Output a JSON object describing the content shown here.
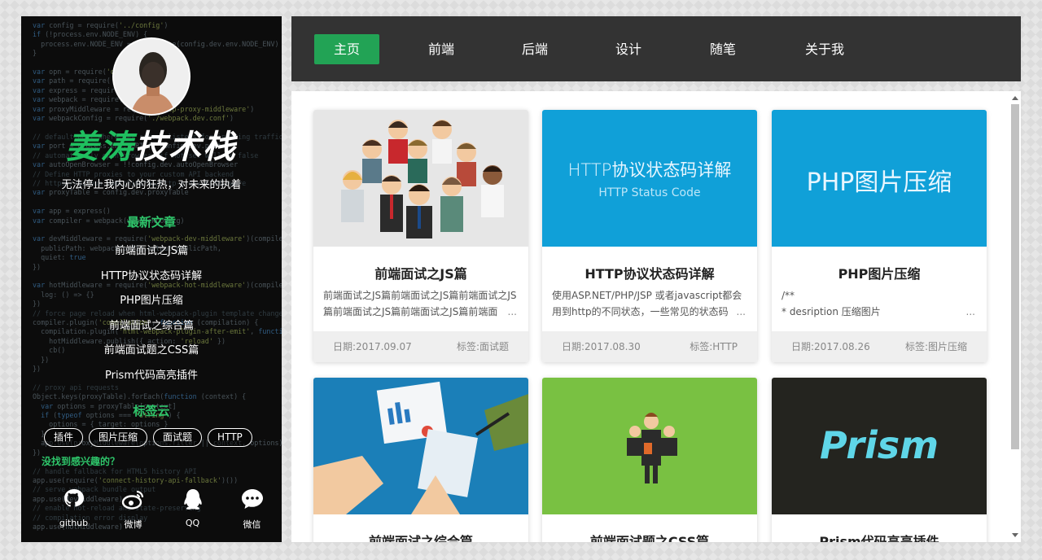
{
  "sidebar": {
    "title_part1": "姜涛",
    "title_part2": "技术栈",
    "motto": "无法停止我内心的狂热，对未来的执着",
    "recent_title": "最新文章",
    "recent": [
      "前端面试之JS篇",
      "HTTP协议状态码详解",
      "PHP图片压缩",
      "前端面试之综合篇",
      "前端面试题之CSS篇",
      "Prism代码高亮插件"
    ],
    "tag_title": "标签云",
    "tags": [
      "插件",
      "图片压缩",
      "面试题",
      "HTTP"
    ],
    "interest": "没找到感兴趣的？",
    "socials": [
      {
        "label": "github",
        "icon": "github-icon"
      },
      {
        "label": "微博",
        "icon": "weibo-icon"
      },
      {
        "label": "QQ",
        "icon": "qq-icon"
      },
      {
        "label": "微信",
        "icon": "wechat-icon"
      }
    ]
  },
  "nav": {
    "items": [
      "主页",
      "前端",
      "后端",
      "设计",
      "随笔",
      "关于我"
    ],
    "active_index": 0,
    "active_color": "#22a355"
  },
  "cards": [
    {
      "title": "前端面试之JS篇",
      "excerpt": "前端面试之JS篇前端面试之JS篇前端面试之JS篇前端面试之JS篇前端面试之JS篇前端面",
      "more": "...",
      "date": "日期:2017.09.07",
      "tag": "标签:面试题",
      "thumb_color": "#e6e6e6"
    },
    {
      "title": "HTTP协议状态码详解",
      "excerpt": "使用ASP.NET/PHP/JSP 或者javascript都会用到http的不同状态，一些常见的状态码",
      "more": "...",
      "date": "日期:2017.08.30",
      "tag": "标签:HTTP",
      "thumb_title": "HTTP协议状态码详解",
      "thumb_sub": "HTTP Status Code",
      "thumb_color": "#10a0d8"
    },
    {
      "title": "PHP图片压缩",
      "excerpt_l1": "/**",
      "excerpt_l2": "* desription 压缩图片",
      "more": "...",
      "date": "日期:2017.08.26",
      "tag": "标签:图片压缩",
      "thumb_title": "PHP图片压缩",
      "thumb_color": "#10a0d8"
    },
    {
      "title": "前端面试之综合篇",
      "thumb_color": "#1b7fb8"
    },
    {
      "title": "前端面试题之CSS篇",
      "thumb_color": "#79c142"
    },
    {
      "title": "Prism代码高亮插件",
      "thumb_title": "Prism",
      "thumb_color": "#24241f"
    }
  ]
}
